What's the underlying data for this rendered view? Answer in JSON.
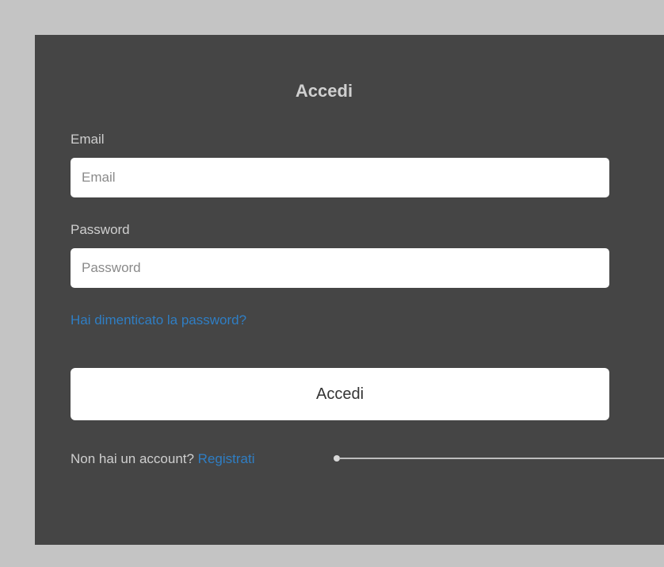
{
  "form": {
    "title": "Accedi",
    "email_label": "Email",
    "email_placeholder": "Email",
    "email_value": "",
    "password_label": "Password",
    "password_placeholder": "Password",
    "password_value": "",
    "forgot_link": "Hai dimenticato la password?",
    "submit_label": "Accedi",
    "signup_prompt": "Non hai un account?",
    "signup_link": "Registrati"
  },
  "colors": {
    "page_background": "#c4c4c4",
    "panel_background": "#454545",
    "link": "#2f7ec4",
    "label_text": "#cfcfcf"
  }
}
